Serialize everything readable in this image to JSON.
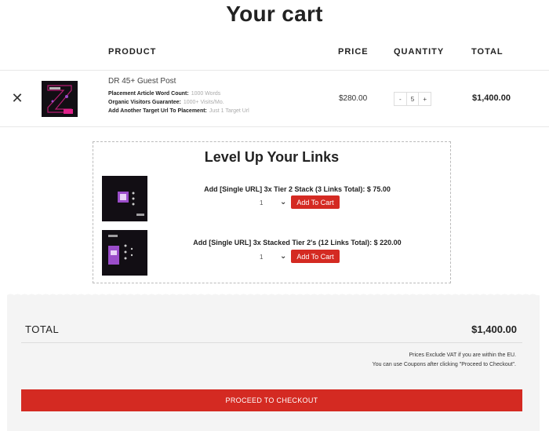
{
  "page_title": "Your cart",
  "table": {
    "headers": {
      "product": "PRODUCT",
      "price": "PRICE",
      "quantity": "QUANTITY",
      "total": "TOTAL"
    }
  },
  "cart_item": {
    "remove": "✕",
    "name": "DR 45+ Guest Post",
    "meta": [
      {
        "label": "Placement Article Word Count:",
        "value": "1000 Words"
      },
      {
        "label": "Organic Visitors Guarantee:",
        "value": "1000+ Visits/Mo."
      },
      {
        "label": "Add Another Target Url To Placement:",
        "value": "Just 1 Target Url"
      }
    ],
    "price": "$280.00",
    "quantity": {
      "minus": "-",
      "value": "5",
      "plus": "+"
    },
    "total": "$1,400.00"
  },
  "upsell": {
    "title": "Level Up Your Links",
    "offers": [
      {
        "text": "Add [Single URL] 3x Tier 2 Stack (3 Links Total): $ 75.00",
        "qty": "1",
        "button": "Add To Cart"
      },
      {
        "text": "Add [Single URL] 3x Stacked Tier 2's (12 Links Total): $ 220.00",
        "qty": "1",
        "button": "Add To Cart"
      }
    ]
  },
  "summary": {
    "label": "TOTAL",
    "value": "$1,400.00",
    "note1": "Prices Exclude VAT if you are within the EU.",
    "note2": "You can use Coupons after clicking \"Proceed to Checkout\".",
    "checkout": "PROCEED TO CHECKOUT"
  },
  "colors": {
    "accent": "#d42a22",
    "panel": "#f4f4f4",
    "thumb_bg": "#120e14",
    "thumb_pink": "#e0218a",
    "thumb_purple": "#9b4dca"
  }
}
